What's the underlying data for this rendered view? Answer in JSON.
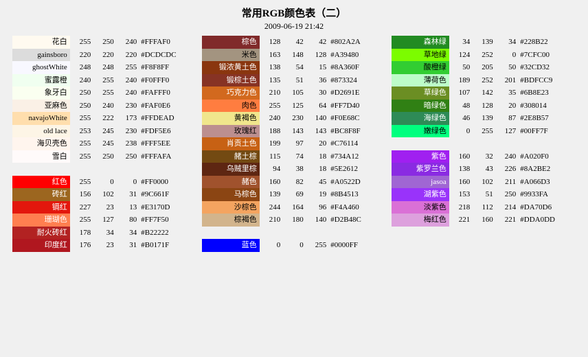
{
  "title": "常用RGB颜色表（二）",
  "subtitle": "2009-06-19 21:42",
  "columns": {
    "left": [
      {
        "name": "花白",
        "r": 255,
        "g": 250,
        "b": 240,
        "hex": "#FFFAF0",
        "bg": "#FFFAF0",
        "text": "#000"
      },
      {
        "name": "gainsboro",
        "r": 220,
        "g": 220,
        "b": 220,
        "hex": "#DCDCDC",
        "bg": "#DCDCDC",
        "text": "#000"
      },
      {
        "name": "ghostWhite",
        "r": 248,
        "g": 248,
        "b": 255,
        "hex": "#F8F8FF",
        "bg": "#F8F8FF",
        "text": "#000"
      },
      {
        "name": "蜜露橙",
        "r": 240,
        "g": 255,
        "b": 240,
        "hex": "#F0FFF0",
        "bg": "#F0FFF0",
        "text": "#000"
      },
      {
        "name": "象牙白",
        "r": 250,
        "g": 255,
        "b": 240,
        "hex": "#FAFFF0",
        "bg": "#FAFFF0",
        "text": "#000"
      },
      {
        "name": "亚麻色",
        "r": 250,
        "g": 240,
        "b": 230,
        "hex": "#FAF0E6",
        "bg": "#FAF0E6",
        "text": "#000"
      },
      {
        "name": "navajoWhite",
        "r": 255,
        "g": 222,
        "b": 173,
        "hex": "#FFDEAD",
        "bg": "#FFDEAD",
        "text": "#000"
      },
      {
        "name": "old lace",
        "r": 253,
        "g": 245,
        "b": 230,
        "hex": "#FDF5E6",
        "bg": "#FDF5E6",
        "text": "#000"
      },
      {
        "name": "海贝壳色",
        "r": 255,
        "g": 245,
        "b": 238,
        "hex": "#FFF5EE",
        "bg": "#FFF5EE",
        "text": "#000"
      },
      {
        "name": "雪白",
        "r": 255,
        "g": 250,
        "b": 250,
        "hex": "#FFFAFA",
        "bg": "#FFFAFA",
        "text": "#000"
      },
      {
        "name": "",
        "r": null,
        "g": null,
        "b": null,
        "hex": "",
        "bg": "",
        "text": ""
      },
      {
        "name": "红色",
        "r": 255,
        "g": 0,
        "b": 0,
        "hex": "#FF0000",
        "bg": "#FF0000",
        "text": "#FFF"
      },
      {
        "name": "砖红",
        "r": 156,
        "g": 102,
        "b": 31,
        "hex": "#9C661F",
        "bg": "#9C661F",
        "text": "#FFF"
      },
      {
        "name": "镉红",
        "r": 227,
        "g": 23,
        "b": 13,
        "hex": "#E3170D",
        "bg": "#E3170D",
        "text": "#FFF"
      },
      {
        "name": "珊瑚色",
        "r": 255,
        "g": 127,
        "b": 80,
        "hex": "#FF7F50",
        "bg": "#FF7F50",
        "text": "#FFF"
      },
      {
        "name": "耐火砖红",
        "r": 178,
        "g": 34,
        "b": 34,
        "hex": "#B22222",
        "bg": "#B22222",
        "text": "#FFF"
      },
      {
        "name": "印度红",
        "r": 176,
        "g": 23,
        "b": 31,
        "hex": "#B0171F",
        "bg": "#B0171F",
        "text": "#FFF"
      }
    ],
    "middle": [
      {
        "name": "棕色",
        "r": 128,
        "g": 42,
        "b": 42,
        "hex": "#802A2A",
        "bg": "#802A2A",
        "text": "#FFF"
      },
      {
        "name": "米色",
        "r": 163,
        "g": 148,
        "b": 128,
        "hex": "#A39480",
        "bg": "#A39480",
        "text": "#000"
      },
      {
        "name": "锻浓黄土色",
        "r": 138,
        "g": 54,
        "b": 15,
        "hex": "#8A360F",
        "bg": "#8A360F",
        "text": "#FFF"
      },
      {
        "name": "锻棕土色",
        "r": 135,
        "g": 51,
        "b": 36,
        "hex": "#873324",
        "bg": "#873324",
        "text": "#FFF"
      },
      {
        "name": "巧克力色",
        "r": 210,
        "g": 105,
        "b": 30,
        "hex": "#D2691E",
        "bg": "#D2691E",
        "text": "#FFF"
      },
      {
        "name": "肉色",
        "r": 255,
        "g": 125,
        "b": 64,
        "hex": "#FF7D40",
        "bg": "#FF7D40",
        "text": "#000"
      },
      {
        "name": "黄褐色",
        "r": 240,
        "g": 230,
        "b": 140,
        "hex": "#F0E68C",
        "bg": "#F0E68C",
        "text": "#000"
      },
      {
        "name": "玫瑰红",
        "r": 188,
        "g": 143,
        "b": 143,
        "hex": "#BC8F8F",
        "bg": "#BC8F8F",
        "text": "#000"
      },
      {
        "name": "肖贡土色",
        "r": 199,
        "g": 97,
        "b": 20,
        "hex": "#C76114",
        "bg": "#C76114",
        "text": "#FFF"
      },
      {
        "name": "赭土棕",
        "r": 115,
        "g": 74,
        "b": 18,
        "hex": "#734A12",
        "bg": "#734A12",
        "text": "#FFF"
      },
      {
        "name": "乌贼里棕",
        "r": 94,
        "g": 38,
        "b": 18,
        "hex": "#5E2612",
        "bg": "#5E2612",
        "text": "#FFF"
      },
      {
        "name": "赭色",
        "r": 160,
        "g": 82,
        "b": 45,
        "hex": "#A0522D",
        "bg": "#A0522D",
        "text": "#FFF"
      },
      {
        "name": "马棕色",
        "r": 139,
        "g": 69,
        "b": 19,
        "hex": "#8B4513",
        "bg": "#8B4513",
        "text": "#FFF"
      },
      {
        "name": "沙棕色",
        "r": 244,
        "g": 164,
        "b": 96,
        "hex": "#F4A460",
        "bg": "#F4A460",
        "text": "#000"
      },
      {
        "name": "棕褐色",
        "r": 210,
        "g": 180,
        "b": 140,
        "hex": "#D2B48C",
        "bg": "#D2B48C",
        "text": "#000"
      },
      {
        "name": "",
        "r": null,
        "g": null,
        "b": null,
        "hex": "",
        "bg": "",
        "text": ""
      },
      {
        "name": "蓝色",
        "r": 0,
        "g": 0,
        "b": 255,
        "hex": "#0000FF",
        "bg": "#0000FF",
        "text": "#FFF"
      }
    ],
    "right": [
      {
        "name": "森林绿",
        "r": 34,
        "g": 139,
        "b": 34,
        "hex": "#228B22",
        "bg": "#228B22",
        "text": "#FFF"
      },
      {
        "name": "草地绿",
        "r": 124,
        "g": 252,
        "b": 0,
        "hex": "#7CFC00",
        "bg": "#7CFC00",
        "text": "#000"
      },
      {
        "name": "酸橙绿",
        "r": 50,
        "g": 205,
        "b": 50,
        "hex": "#32CD32",
        "bg": "#32CD32",
        "text": "#000"
      },
      {
        "name": "薄荷色",
        "r": 189,
        "g": 252,
        "b": 201,
        "hex": "#BDFCC9",
        "bg": "#BDFCC9",
        "text": "#000"
      },
      {
        "name": "草绿色",
        "r": 107,
        "g": 142,
        "b": 35,
        "hex": "#6B8E23",
        "bg": "#6B8E23",
        "text": "#FFF"
      },
      {
        "name": "暗绿色",
        "r": 48,
        "g": 128,
        "b": 20,
        "hex": "#308014",
        "bg": "#308014",
        "text": "#FFF"
      },
      {
        "name": "海绿色",
        "r": 46,
        "g": 139,
        "b": 87,
        "hex": "#2E8B57",
        "bg": "#2E8B57",
        "text": "#FFF"
      },
      {
        "name": "嫩绿色",
        "r": 0,
        "g": 255,
        "b": 127,
        "hex": "#00FF7F",
        "bg": "#00FF7F",
        "text": "#000"
      },
      {
        "name": "",
        "r": null,
        "g": null,
        "b": null,
        "hex": "",
        "bg": "",
        "text": ""
      },
      {
        "name": "紫色",
        "r": 160,
        "g": 32,
        "b": 240,
        "hex": "#A020F0",
        "bg": "#A020F0",
        "text": "#FFF"
      },
      {
        "name": "紫罗兰色",
        "r": 138,
        "g": 43,
        "b": 226,
        "hex": "#8A2BE2",
        "bg": "#8A2BE2",
        "text": "#FFF"
      },
      {
        "name": "jasoa",
        "r": 160,
        "g": 102,
        "b": 211,
        "hex": "#A066D3",
        "bg": "#A066D3",
        "text": "#FFF"
      },
      {
        "name": "湖紫色",
        "r": 153,
        "g": 51,
        "b": 250,
        "hex": "#9933FA",
        "bg": "#9933FA",
        "text": "#FFF"
      },
      {
        "name": "淡紫色",
        "r": 218,
        "g": 112,
        "b": 214,
        "hex": "#DA70D6",
        "bg": "#DA70D6",
        "text": "#000"
      },
      {
        "name": "梅红色",
        "r": 221,
        "g": 160,
        "b": 221,
        "hex": "#DDA0DD",
        "bg": "#DDA0DD",
        "text": "#000"
      },
      {
        "name": "",
        "r": null,
        "g": null,
        "b": null,
        "hex": "",
        "bg": "",
        "text": ""
      }
    ]
  }
}
